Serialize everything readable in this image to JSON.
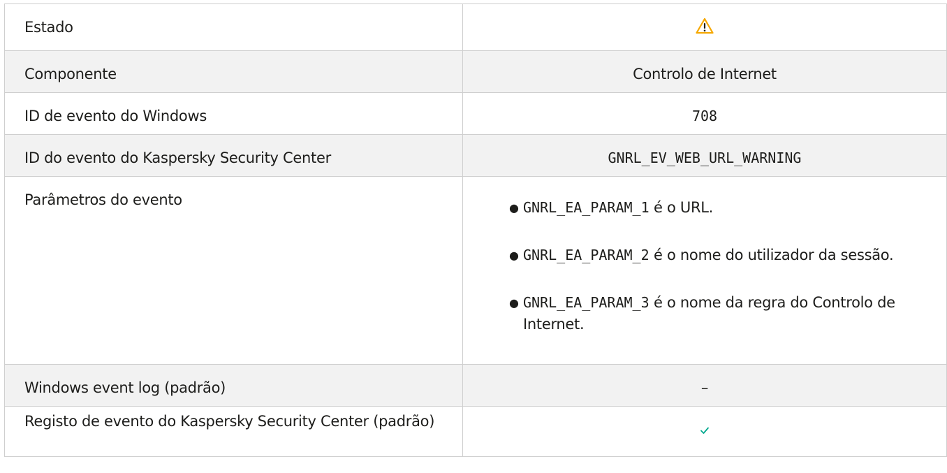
{
  "rows": {
    "estado": {
      "label": "Estado",
      "status_icon": "warning-icon",
      "status_color": "#f6a800"
    },
    "componente": {
      "label": "Componente",
      "value": "Controlo de Internet"
    },
    "windows_id": {
      "label": "ID de evento do Windows",
      "value": "708"
    },
    "ksc_id": {
      "label": "ID do evento do Kaspersky Security Center",
      "value": "GNRL_EV_WEB_URL_WARNING"
    },
    "parametros": {
      "label": "Parâmetros do evento",
      "items": [
        {
          "code": "GNRL_EA_PARAM_1",
          "text": " é o URL."
        },
        {
          "code": "GNRL_EA_PARAM_2",
          "text": " é o nome do utilizador da sessão."
        },
        {
          "code": "GNRL_EA_PARAM_3",
          "text": " é o nome da regra do Controlo de Internet."
        }
      ]
    },
    "windows_log": {
      "label": "Windows event log (padrão)",
      "value": "–"
    },
    "ksc_log": {
      "label": "Registo de evento do Kaspersky Security Center (padrão)",
      "value_icon": "checkmark-icon",
      "check_color": "#00a88e"
    }
  }
}
